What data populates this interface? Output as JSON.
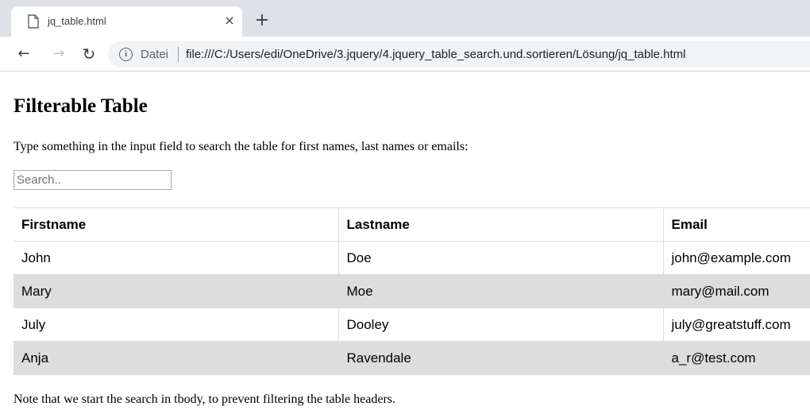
{
  "browser": {
    "tab_title": "jq_table.html",
    "tab_close": "×",
    "new_tab": "+",
    "back": "←",
    "forward": "→",
    "reload": "↻",
    "info": "i",
    "security_label": "Datei",
    "url": "file:///C:/Users/edi/OneDrive/3.jquery/4.jquery_table_search.und.sortieren/Lösung/jq_table.html"
  },
  "page": {
    "title": "Filterable Table",
    "intro": "Type something in the input field to search the table for first names, last names or emails:",
    "search": {
      "placeholder": "Search..",
      "value": ""
    },
    "table": {
      "headers": [
        "Firstname",
        "Lastname",
        "Email"
      ],
      "rows": [
        [
          "John",
          "Doe",
          "john@example.com"
        ],
        [
          "Mary",
          "Moe",
          "mary@mail.com"
        ],
        [
          "July",
          "Dooley",
          "july@greatstuff.com"
        ],
        [
          "Anja",
          "Ravendale",
          "a_r@test.com"
        ]
      ]
    },
    "note": "Note that we start the search in tbody, to prevent filtering the table headers."
  },
  "colors": {
    "tabstrip_bg": "#dee1e6",
    "omnibox_bg": "#f1f3f4",
    "row_stripe": "#dddddd",
    "border": "#dddddd"
  }
}
